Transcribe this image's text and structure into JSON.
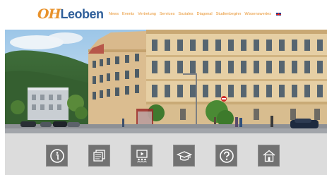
{
  "brand": {
    "logo_prefix": "OH",
    "logo_name": "Leoben",
    "primary_color": "#e8922c",
    "secondary_color": "#2f5f9a"
  },
  "nav": {
    "items": [
      {
        "label": "News"
      },
      {
        "label": "Events"
      },
      {
        "label": "Vertretung"
      },
      {
        "label": "Services"
      },
      {
        "label": "Soziales"
      },
      {
        "label": "Diagonal"
      },
      {
        "label": "Studienbeginn"
      },
      {
        "label": "Wissenswertes"
      }
    ],
    "language_flag": "uk-flag-icon"
  },
  "hero": {
    "image": "university-building-photo"
  },
  "icon_bar": {
    "tiles": [
      {
        "icon": "info-icon"
      },
      {
        "icon": "news-icon"
      },
      {
        "icon": "presentation-icon"
      },
      {
        "icon": "graduation-cap-icon"
      },
      {
        "icon": "question-icon"
      },
      {
        "icon": "home-icon"
      }
    ]
  }
}
